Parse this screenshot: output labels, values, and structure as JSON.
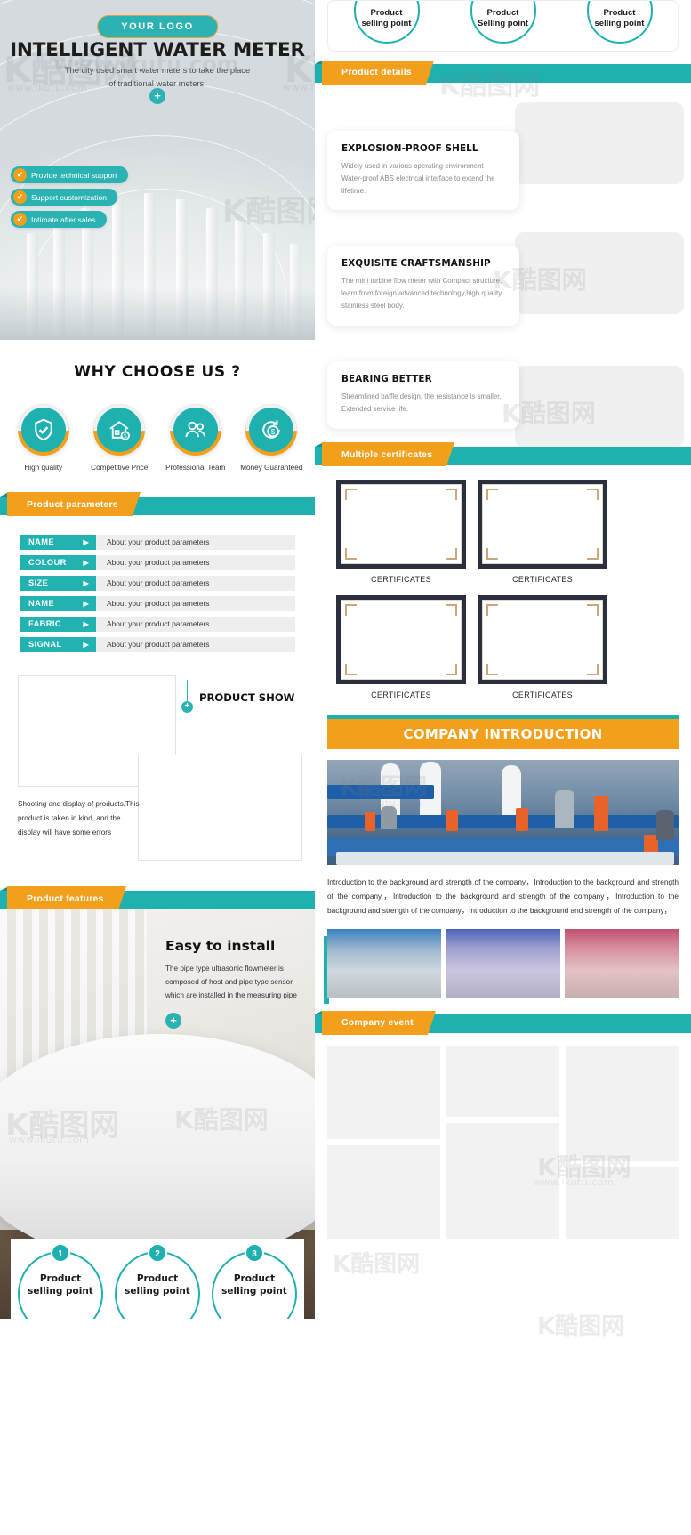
{
  "hero": {
    "logo": "YOUR  LOGO",
    "title": "INTELLIGENT WATER METER",
    "subtitle_line1": "The city used smart water meters to take the place",
    "subtitle_line2": "of traditional water meters.",
    "plus": "+",
    "tags": [
      "Provide technical support",
      "Support customization",
      "Intimate after sales"
    ]
  },
  "why": {
    "title": "WHY CHOOSE US ?",
    "items": [
      {
        "label": "High quality",
        "icon": "shield-check-icon"
      },
      {
        "label": "Competitive Price",
        "icon": "house-dollar-icon"
      },
      {
        "label": "Professional Team",
        "icon": "people-icon"
      },
      {
        "label": "Money  Guaranteed",
        "icon": "money-back-icon"
      }
    ]
  },
  "sections": {
    "product_parameters": "Product parameters",
    "product_features": "Product features",
    "product_details": "Product details",
    "multiple_certificates": "Multiple certificates",
    "company_introduction": "COMPANY INTRODUCTION",
    "company_event": "Company event"
  },
  "parameters": {
    "rows": [
      {
        "key": "NAME",
        "value": "About your product parameters"
      },
      {
        "key": "COLOUR",
        "value": "About your product parameters"
      },
      {
        "key": "SIZE",
        "value": "About your product parameters"
      },
      {
        "key": "NAME",
        "value": "About your product parameters"
      },
      {
        "key": "FABRIC",
        "value": "About your product parameters"
      },
      {
        "key": "SIGNAL",
        "value": "About your product parameters"
      }
    ],
    "arrow": "▶"
  },
  "product_show": {
    "title": "PRODUCT SHOW",
    "plus": "+",
    "caption": "Shooting and display of products,This product is taken in kind, and the display will have some errors"
  },
  "feature": {
    "title": "Easy to install",
    "desc": "The pipe type ultrasonic flowmeter is composed of host and pipe type sensor, which are installed in the measuring pipe",
    "plus": "+"
  },
  "selling_points": [
    {
      "num": "1",
      "line1": "Product",
      "line2": "selling point"
    },
    {
      "num": "2",
      "line1": "Product",
      "line2": "selling point"
    },
    {
      "num": "3",
      "line1": "Product",
      "line2": "selling point"
    }
  ],
  "top_circles": [
    {
      "line1": "Product",
      "line2": "selling point"
    },
    {
      "line1": "Product",
      "line2": "Selling point"
    },
    {
      "line1": "Product",
      "line2": "selling point"
    }
  ],
  "details": [
    {
      "title": "EXPLOSION-PROOF SHELL",
      "desc": "Widely used in various operating environment Water-proof ABS electrical interface to extend the lifetime."
    },
    {
      "title": "EXQUISITE CRAFTSMANSHIP",
      "desc": "The mini turbine flow meter with Compact structure, learn from foreign advanced technology,high quality stainless steel body."
    },
    {
      "title": "BEARING BETTER",
      "desc": "Streamlined baffle design, the resistance is smaller. Extended service life."
    }
  ],
  "certificates": [
    {
      "caption": "CERTIFICATES"
    },
    {
      "caption": "CERTIFICATES"
    },
    {
      "caption": "CERTIFICATES"
    },
    {
      "caption": "CERTIFICATES"
    }
  ],
  "company": {
    "paragraph": "Introduction to the background and strength of the company，Introduction to the background and strength of the company，Introduction to the background and strength of the company，Introduction to the background and strength of the company，Introduction to the background and strength of the company，"
  },
  "watermarks": {
    "brand": "K酷图网",
    "url": "www.ikutu.com"
  },
  "colors": {
    "teal": "#1fb0b0",
    "orange": "#f29f1c",
    "dark": "#2c2f3e",
    "gray_value_bg": "#eeeeee"
  }
}
